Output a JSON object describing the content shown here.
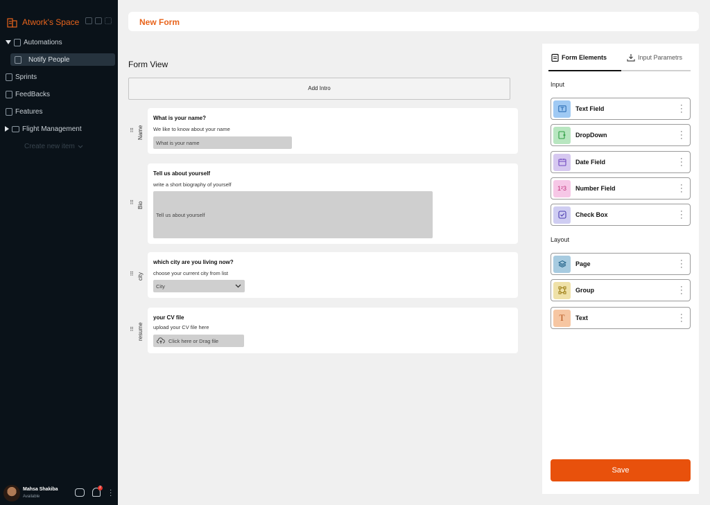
{
  "sidebar": {
    "workspace": "Atwork's Space",
    "automations": "Automations",
    "notify_people": "Notify People",
    "sprints": "Sprints",
    "feedbacks": "FeedBacks",
    "features": "Features",
    "flight_management": "Flight Management",
    "create_new_item": "Create new item",
    "user": {
      "name": "Mahsa Shakiba",
      "status": "Available",
      "notifications": "2"
    }
  },
  "header": {
    "title": "New Form"
  },
  "form_view": {
    "title": "Form View",
    "add_intro": "Add Intro",
    "questions": [
      {
        "key": "Name",
        "label": "What is your name?",
        "help": "We like to know about your name",
        "placeholder": "What is your name"
      },
      {
        "key": "Bio",
        "label": "Tell us about yourself",
        "help": "write a short biography of yourself",
        "placeholder": "Tell us about yourself"
      },
      {
        "key": "city",
        "label": "which city are you living now?",
        "help": "choose your current city from list",
        "placeholder": "City"
      },
      {
        "key": "resume",
        "label": "your CV file",
        "help": "upload your CV file here",
        "placeholder": "Click here or Drag file"
      }
    ]
  },
  "panel": {
    "tabs": [
      "Form Elements",
      "Input Parametrs"
    ],
    "input_label": "Input",
    "layout_label": "Layout",
    "input_items": [
      {
        "label": "Text Field",
        "icon": "text-field-icon",
        "color": "#9fc9f3"
      },
      {
        "label": "DropDown",
        "icon": "dropdown-icon",
        "color": "#b8e6c0"
      },
      {
        "label": "Date Field",
        "icon": "calendar-icon",
        "color": "#d6c8f0"
      },
      {
        "label": "Number Field",
        "icon": "number-icon",
        "color": "#f6c7e6",
        "glyph": "1²3"
      },
      {
        "label": "Check Box",
        "icon": "checkbox-icon",
        "color": "#cfcdf2"
      }
    ],
    "layout_items": [
      {
        "label": "Page",
        "icon": "page-layers-icon",
        "color": "#a7cbe0"
      },
      {
        "label": "Group",
        "icon": "group-icon",
        "color": "#efe1a8"
      },
      {
        "label": "Text",
        "icon": "text-icon",
        "color": "#f6c6a2",
        "glyph": "T"
      }
    ],
    "save": "Save"
  }
}
